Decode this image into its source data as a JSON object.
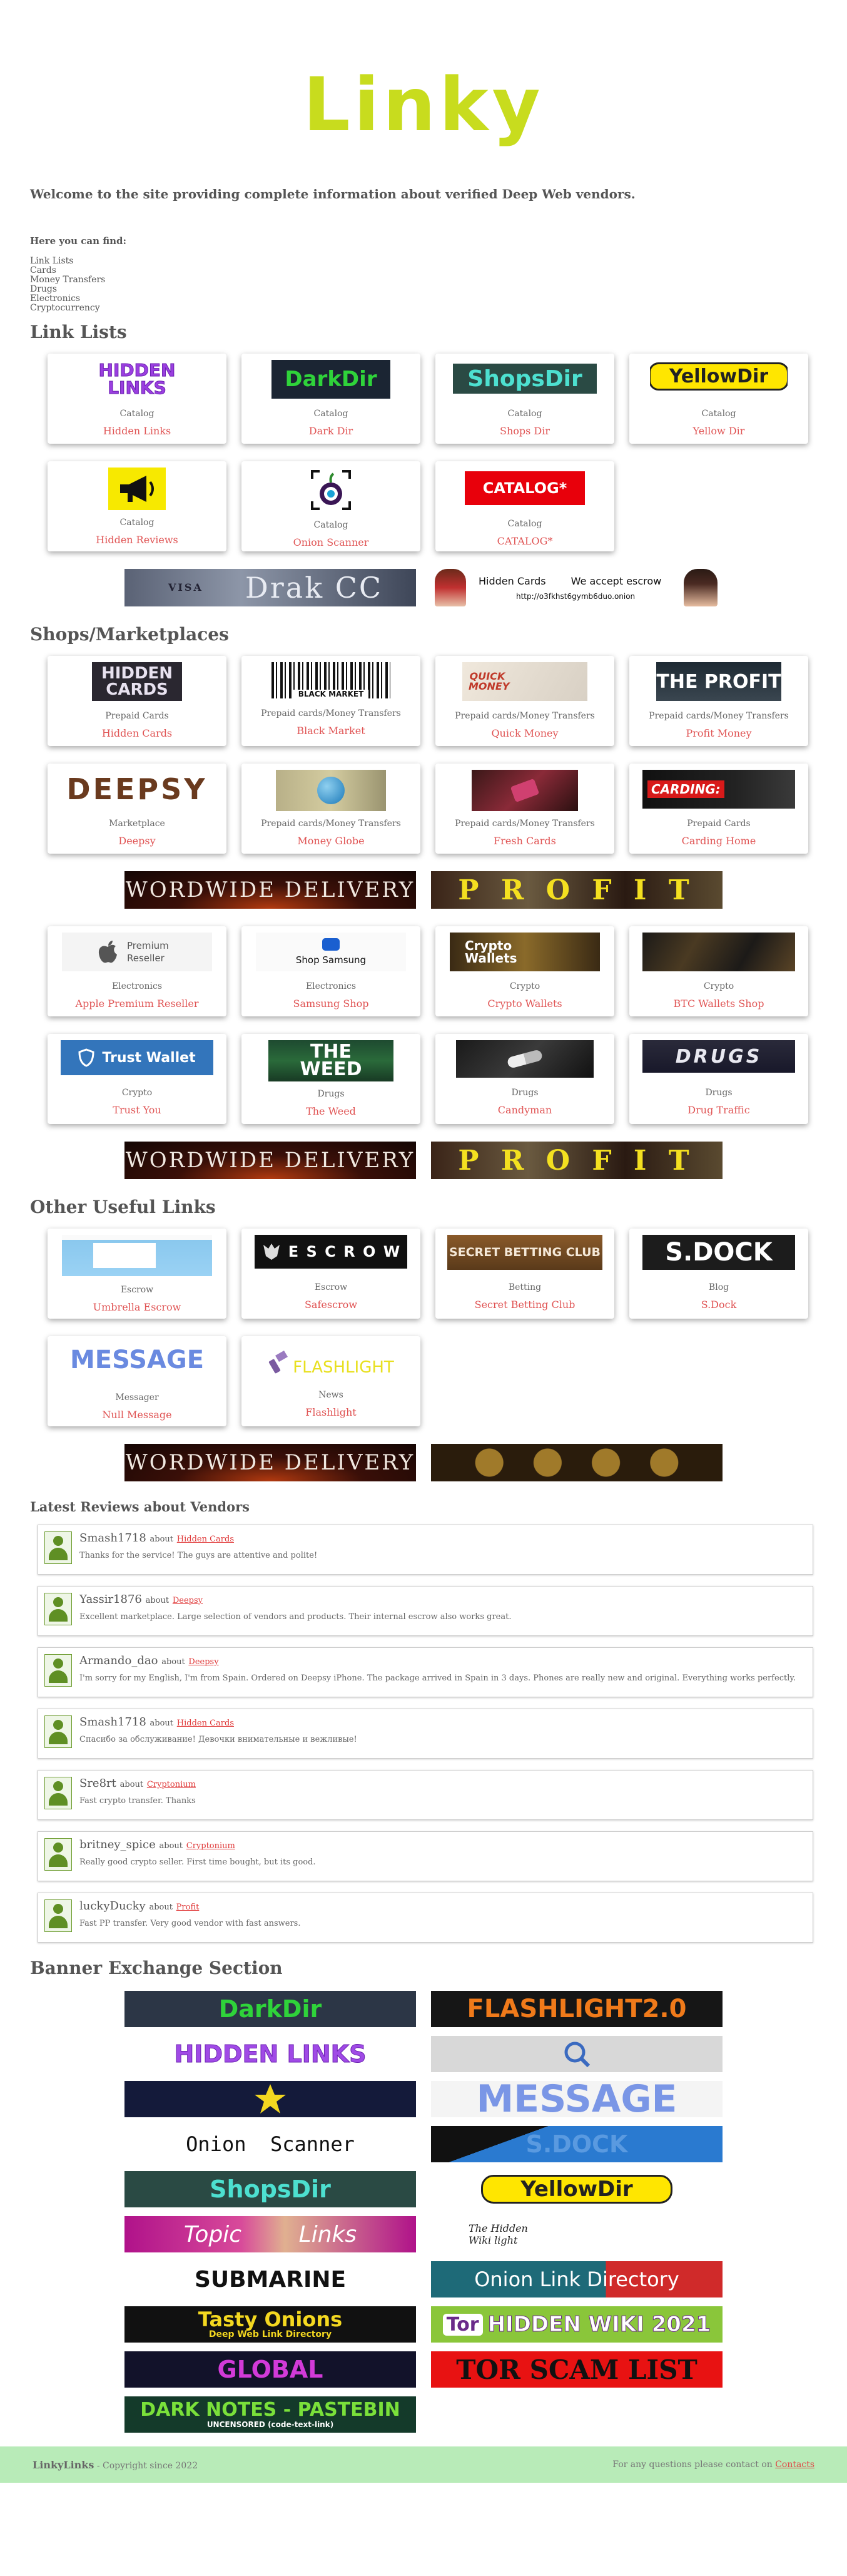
{
  "brand": {
    "logo": "Linky"
  },
  "intro": {
    "welcome": "Welcome to the site providing complete information about verified Deep Web vendors.",
    "find_title": "Here you can find:",
    "find_items": [
      "Link Lists",
      "Cards",
      "Money Transfers",
      "Drugs",
      "Electronics",
      "Cryptocurrency"
    ]
  },
  "sections": {
    "link_lists": "Link Lists",
    "shops": "Shops/Marketplaces",
    "other": "Other Useful Links",
    "reviews": "Latest Reviews about Vendors",
    "banners": "Banner Exchange Section"
  },
  "link_lists": [
    {
      "img": "HIDDEN LINKS",
      "cat": "Catalog",
      "name": "Hidden Links"
    },
    {
      "img": "DarkDir",
      "cat": "Catalog",
      "name": "Dark Dir"
    },
    {
      "img": "ShopsDir",
      "cat": "Catalog",
      "name": "Shops Dir"
    },
    {
      "img": "YellowDir",
      "cat": "Catalog",
      "name": "Yellow Dir"
    },
    {
      "img": "",
      "cat": "Catalog",
      "name": "Hidden Reviews"
    },
    {
      "img": "",
      "cat": "Catalog",
      "name": "Onion Scanner"
    },
    {
      "img": "CATALOG*",
      "cat": "Catalog",
      "name": "CATALOG*"
    }
  ],
  "banner1": {
    "left": "Drak CC",
    "right_title": "Hidden Cards",
    "right_sub": "We accept escrow",
    "right_url": "http://o3fkhst6gymb6duo.onion",
    "left_small": "VISA"
  },
  "shops_a": [
    {
      "img": "HIDDEN CARDS",
      "cat": "Prepaid Cards",
      "name": "Hidden Cards"
    },
    {
      "img": "BLACK MARKET",
      "cat": "Prepaid cards/Money Transfers",
      "name": "Black Market"
    },
    {
      "img": "QUICK MONEY",
      "cat": "Prepaid cards/Money Transfers",
      "name": "Quick Money"
    },
    {
      "img": "THE PROFIT",
      "cat": "Prepaid cards/Money Transfers",
      "name": "Profit Money"
    },
    {
      "img": "DEEPSY",
      "cat": "Marketplace",
      "name": "Deepsy"
    },
    {
      "img": "",
      "cat": "Prepaid cards/Money Transfers",
      "name": "Money Globe"
    },
    {
      "img": "",
      "cat": "Prepaid cards/Money Transfers",
      "name": "Fresh Cards"
    },
    {
      "img": "CARDING:",
      "cat": "Prepaid Cards",
      "name": "Carding Home"
    }
  ],
  "banner2": {
    "left": "WORDWIDE DELIVERY",
    "right": "P R O F I T"
  },
  "shops_b": [
    {
      "img": "Premium Reseller",
      "cat": "Electronics",
      "name": "Apple Premium Reseller"
    },
    {
      "img": "Shop Samsung",
      "cat": "Electronics",
      "name": "Samsung Shop"
    },
    {
      "img": "Crypto Wallets",
      "cat": "Crypto",
      "name": "Crypto Wallets"
    },
    {
      "img": "",
      "cat": "Crypto",
      "name": "BTC Wallets Shop"
    },
    {
      "img": "Trust Wallet",
      "cat": "Crypto",
      "name": "Trust You"
    },
    {
      "img": "THE WEED",
      "cat": "Drugs",
      "name": "The Weed"
    },
    {
      "img": "",
      "cat": "Drugs",
      "name": "Candyman"
    },
    {
      "img": "DRUGS",
      "cat": "Drugs",
      "name": "Drug Traffic"
    }
  ],
  "banner3": {
    "left": "WORDWIDE DELIVERY",
    "right": "P R O F I T"
  },
  "other": [
    {
      "img": "",
      "cat": "Escrow",
      "name": "Umbrella Escrow"
    },
    {
      "img": "E S C R O W",
      "cat": "Escrow",
      "name": "Safescrow"
    },
    {
      "img": "SECRET BETTING CLUB",
      "cat": "Betting",
      "name": "Secret Betting Club"
    },
    {
      "img": "S.DOCK",
      "cat": "Blog",
      "name": "S.Dock"
    },
    {
      "img": "MESSAGE",
      "cat": "Messager",
      "name": "Null Message"
    },
    {
      "img": "FLASHLIGHT",
      "cat": "News",
      "name": "Flashlight"
    }
  ],
  "banner4": {
    "left": "WORDWIDE DELIVERY",
    "right": ""
  },
  "reviews": [
    {
      "user": "Smash1718",
      "about": "about",
      "vendor": "Hidden Cards",
      "text": "Thanks for the service! The guys are attentive and polite!"
    },
    {
      "user": "Yassir1876",
      "about": "about",
      "vendor": "Deepsy",
      "text": "Excellent marketplace. Large selection of vendors and products. Their internal escrow also works great."
    },
    {
      "user": "Armando_dao",
      "about": "about",
      "vendor": "Deepsy",
      "text": "I'm sorry for my English, I'm from Spain. Ordered on Deepsy iPhone. The package arrived in Spain in 3 days. Phones are really new and original. Everything works perfectly."
    },
    {
      "user": "Smash1718",
      "about": "about",
      "vendor": "Hidden Cards",
      "text": "Спасибо за обслуживание! Девочки внимательные и вежливые!"
    },
    {
      "user": "Sre8rt",
      "about": "about",
      "vendor": "Cryptonium",
      "text": "Fast crypto transfer. Thanks"
    },
    {
      "user": "britney_spice",
      "about": "about",
      "vendor": "Cryptonium",
      "text": "Really good crypto seller. First time bought, but its good."
    },
    {
      "user": "luckyDucky",
      "about": "about",
      "vendor": "Profit",
      "text": "Fast PP transfer. Very good vendor with fast answers."
    }
  ],
  "banner_exchange": [
    {
      "label": "DarkDir"
    },
    {
      "label": "FLASHLIGHT2.0"
    },
    {
      "label": "HIDDEN LINKS"
    },
    {
      "label": ""
    },
    {
      "label": ""
    },
    {
      "label": "MESSAGE"
    },
    {
      "label": "Onion  Scanner"
    },
    {
      "label": "S.DOCK"
    },
    {
      "label": "ShopsDir"
    },
    {
      "label": "YellowDir"
    },
    {
      "label": "Topic        Links"
    },
    {
      "label": "The Hidden Wiki light"
    },
    {
      "label": "SUBMARINE"
    },
    {
      "label": "Onion Link Directory"
    },
    {
      "label": "Tasty Onions"
    },
    {
      "label": "HIDDEN WIKI 2021"
    },
    {
      "label": "GLOBAL"
    },
    {
      "label": "TOR SCAM LIST"
    },
    {
      "label": "DARK NOTES - PASTEBIN"
    }
  ],
  "banner_extra": {
    "tasty_sub": "Deep Web Link Directory",
    "dark_notes_sub": "UNCENSORED (code-text-link)",
    "hw_prefix": "Tor"
  },
  "footer": {
    "brand": "LinkyLinks",
    "copyright": " - Copyright since 2022",
    "contact_text": "For any questions please contact on ",
    "contact_link": "Contacts"
  },
  "colors": {
    "accent": "#c8dc1e",
    "link": "#e05454",
    "footer_bg": "#b8ebb8"
  }
}
